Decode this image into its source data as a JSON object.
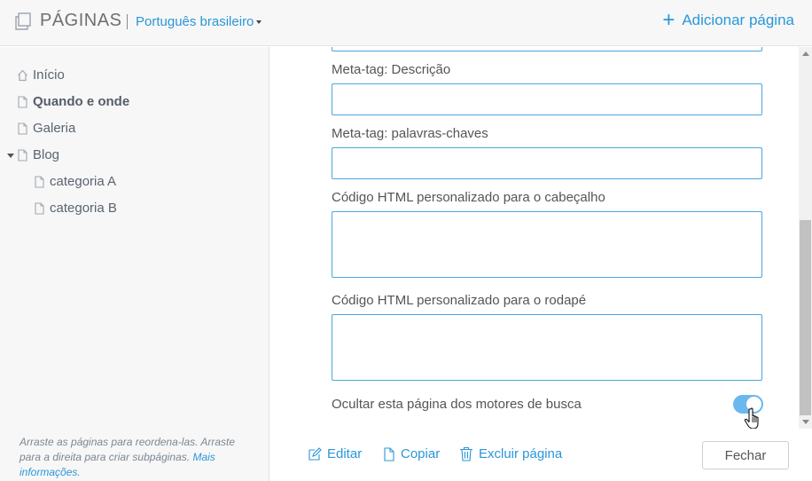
{
  "header": {
    "title": "PÁGINAS",
    "language": "Português brasileiro",
    "add_page": "Adicionar página",
    "icons": {
      "pages": "pages-icon",
      "add": "plus-icon",
      "language_caret": "caret-down-icon"
    }
  },
  "sidebar": {
    "items": [
      {
        "label": "Início",
        "icon": "home-icon",
        "active": false,
        "level": 0
      },
      {
        "label": "Quando e onde",
        "icon": "page-icon",
        "active": true,
        "level": 0
      },
      {
        "label": "Galeria",
        "icon": "page-icon",
        "active": false,
        "level": 0
      },
      {
        "label": "Blog",
        "icon": "page-icon",
        "active": false,
        "level": 0,
        "expanded": true
      },
      {
        "label": "categoria A",
        "icon": "page-icon",
        "active": false,
        "level": 1
      },
      {
        "label": "categoria B",
        "icon": "page-icon",
        "active": false,
        "level": 1
      }
    ],
    "help_text": "Arraste as páginas para reordena-las. Arraste para a direita para criar subpáginas.",
    "help_link": "Mais informações"
  },
  "form": {
    "meta_description_label": "Meta-tag: Descrição",
    "meta_description_value": "",
    "meta_keywords_label": "Meta-tag: palavras-chaves",
    "meta_keywords_value": "",
    "header_html_label": "Código HTML personalizado para o cabeçalho",
    "header_html_value": "",
    "footer_html_label": "Código HTML personalizado para o rodapé",
    "footer_html_value": "",
    "hide_from_search_label": "Ocultar esta página dos motores de busca",
    "hide_from_search_on": true
  },
  "footer": {
    "edit": "Editar",
    "copy": "Copiar",
    "delete": "Excluir página",
    "close": "Fechar",
    "icons": {
      "edit": "pencil-icon",
      "copy": "copy-icon",
      "delete": "trash-icon"
    }
  },
  "colors": {
    "accent": "#2a97d8",
    "border_focus": "#4aa7df",
    "sidebar_bg": "#f7f7f7",
    "toggle_on": "#6ab8ee"
  }
}
